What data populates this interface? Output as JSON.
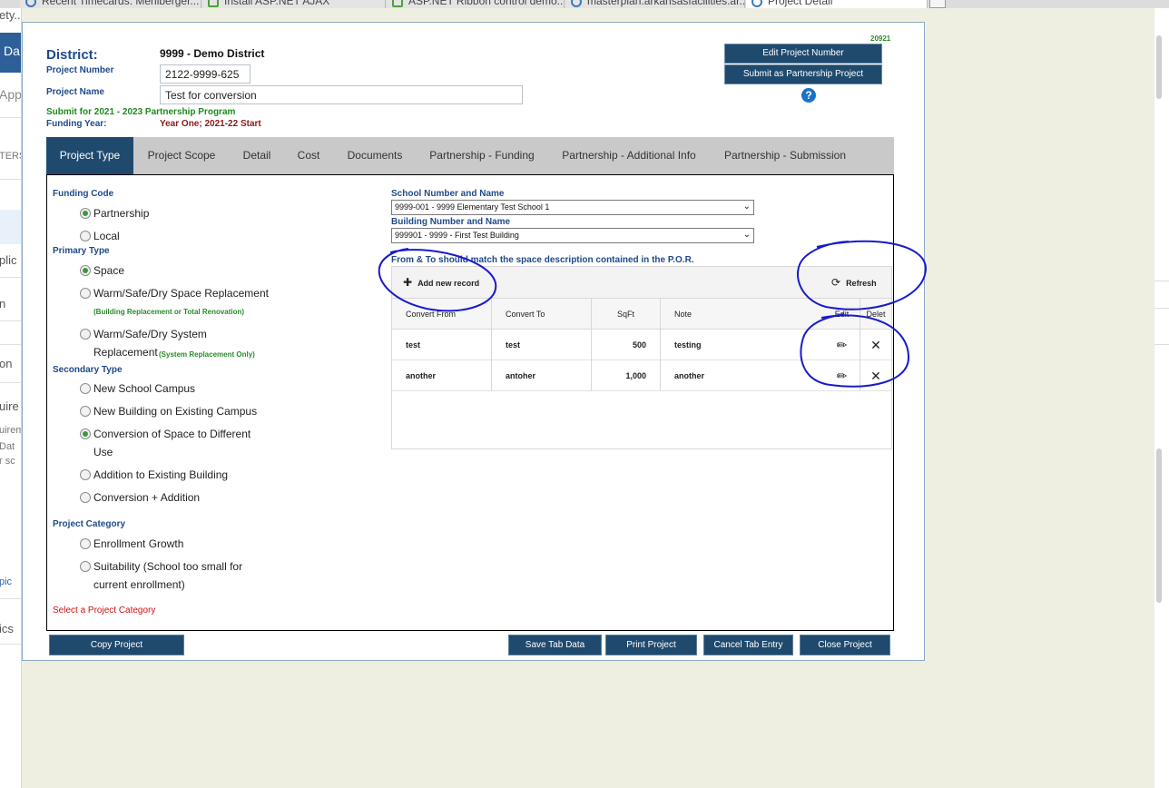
{
  "browser_tabs": [
    {
      "label": "Recent Timecards: Menlberger...",
      "icon": "ie-icon"
    },
    {
      "label": "Install ASP.NET AJAX",
      "icon": "spreadsheet-icon"
    },
    {
      "label": "ASP.NET Ribbon control demo...",
      "icon": "spreadsheet-icon"
    },
    {
      "label": "masterplan.arkansasfacilities.ar...",
      "icon": "ie-icon"
    },
    {
      "label": "Project Detail",
      "icon": "ie-icon"
    }
  ],
  "background_left": {
    "header_fragment": "Da",
    "fragments": [
      "ety...",
      "App",
      "TERS",
      "plic",
      "n",
      "on",
      "uire",
      "uirem",
      "Dat",
      "r sc",
      "pic",
      "ics"
    ]
  },
  "header": {
    "district_label": "District:",
    "district_value": "9999 - Demo District",
    "project_number_label": "Project Number",
    "project_number_value": "2122-9999-625",
    "project_name_label": "Project Name",
    "project_name_value": "Test for conversion",
    "submit_text": "Submit for 2021 - 2023 Partnership Program",
    "funding_year_label": "Funding Year:",
    "funding_year_value": "Year One; 2021-22 Start",
    "project_id": "20921",
    "edit_project_number_button": "Edit Project Number",
    "submit_partnership_button": "Submit as Partnership Project",
    "help_glyph": "?"
  },
  "tabs": [
    {
      "label": "Project Type",
      "active": true
    },
    {
      "label": "Project Scope",
      "active": false
    },
    {
      "label": "Detail",
      "active": false
    },
    {
      "label": "Cost",
      "active": false
    },
    {
      "label": "Documents",
      "active": false
    },
    {
      "label": "Partnership - Funding",
      "active": false
    },
    {
      "label": "Partnership - Additional Info",
      "active": false
    },
    {
      "label": "Partnership - Submission",
      "active": false
    }
  ],
  "funding_code": {
    "title": "Funding Code",
    "options": [
      {
        "label": "Partnership",
        "checked": true
      },
      {
        "label": "Local",
        "checked": false
      }
    ]
  },
  "primary_type": {
    "title": "Primary Type",
    "space_label": "Space",
    "warm_space_label": "Warm/Safe/Dry Space Replacement",
    "warm_space_note": "(Building Replacement or Total Renovation)",
    "warm_system_line1": "Warm/Safe/Dry System",
    "warm_system_line2": "Replacement",
    "warm_system_note": "(System Replacement Only)"
  },
  "secondary_type": {
    "title": "Secondary Type",
    "new_school": "New School Campus",
    "new_building": "New Building on Existing Campus",
    "conversion_line1": "Conversion of Space to Different",
    "conversion_line2": "Use",
    "addition": "Addition to Existing Building",
    "conversion_addition": "Conversion + Addition"
  },
  "project_category": {
    "title": "Project Category",
    "enrollment": "Enrollment Growth",
    "suitability_line1": "Suitability (School too small for",
    "suitability_line2": "current enrollment)",
    "error": "Select a Project Category"
  },
  "school": {
    "school_label": "School Number and Name",
    "school_value": "9999-001 - 9999 Elementary Test School 1",
    "building_label": "Building Number and Name",
    "building_value": "999901 - 9999 - First Test Building",
    "instruction": "From & To should match the space description contained in the P.O.R."
  },
  "grid": {
    "add_label": "Add new record",
    "refresh_label": "Refresh",
    "columns": [
      "Convert From",
      "Convert To",
      "SqFt",
      "Note",
      "Edit",
      "Delet"
    ],
    "rows": [
      {
        "from": "test",
        "to": "test",
        "sqft": "500",
        "note": "testing"
      },
      {
        "from": "another",
        "to": "antoher",
        "sqft": "1,000",
        "note": "another"
      }
    ]
  },
  "footer": {
    "copy": "Copy Project",
    "save": "Save Tab Data",
    "print": "Print Project",
    "cancel": "Cancel Tab Entry",
    "close": "Close Project"
  },
  "colors": {
    "navy": "#1f4a6e",
    "title_blue": "#1f4a8a",
    "green": "#1f8a1f",
    "maroon": "#8b1a1a",
    "error_red": "#d01010",
    "annotation": "#1a1acc",
    "page_bg": "#efefe1"
  }
}
